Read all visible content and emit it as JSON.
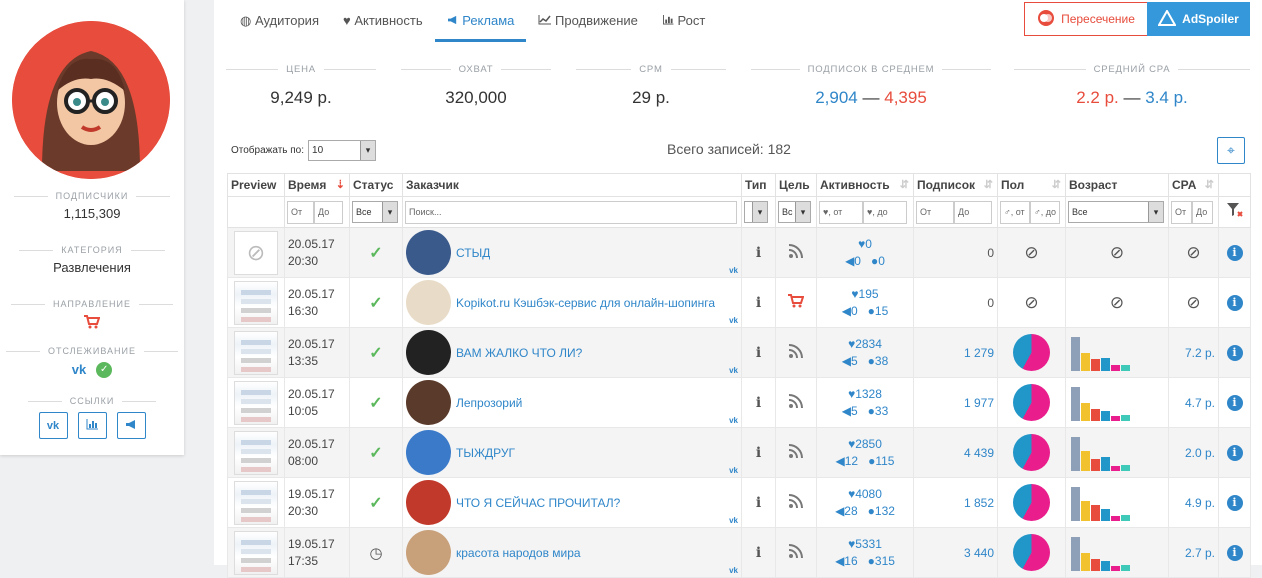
{
  "sidebar": {
    "subscribers_label": "ПОДПИСЧИКИ",
    "subscribers_value": "1,115,309",
    "category_label": "КАТЕГОРИЯ",
    "category_value": "Развлечения",
    "direction_label": "НАПРАВЛЕНИЕ",
    "tracking_label": "ОТСЛЕЖИВАНИЕ",
    "links_label": "ССЫЛКИ",
    "tracking_vk": "vk"
  },
  "tabs": [
    {
      "label": "Аудитория",
      "icon": "globe-icon"
    },
    {
      "label": "Активность",
      "icon": "heart-icon"
    },
    {
      "label": "Реклама",
      "icon": "megaphone-icon"
    },
    {
      "label": "Продвижение",
      "icon": "chart-line-icon"
    },
    {
      "label": "Рост",
      "icon": "bar-chart-icon"
    }
  ],
  "buttons": {
    "intersection": "Пересечение",
    "adspoiler": "AdSpoiler"
  },
  "stats": {
    "price_label": "ЦЕНА",
    "price_value": "9,249 р.",
    "reach_label": "ОХВАТ",
    "reach_value": "320,000",
    "cpm_label": "CPM",
    "cpm_value": "29 р.",
    "subs_label": "ПОДПИСОК В СРЕДНЕМ",
    "subs_min": "2,904",
    "subs_max": "4,395",
    "cpa_label": "СРЕДНИЙ CPA",
    "cpa_min": "2.2 р.",
    "cpa_max": "3.4 р.",
    "dash": "—"
  },
  "controls": {
    "show_label": "Отображать по:",
    "show_value": "10",
    "total": "Всего записей: 182"
  },
  "table": {
    "headers": {
      "preview": "Preview",
      "time": "Время",
      "status": "Статус",
      "customer": "Заказчик",
      "type": "Тип",
      "goal": "Цель",
      "activity": "Активность",
      "subs": "Подписок",
      "gender": "Пол",
      "age": "Возраст",
      "cpa": "CPA"
    },
    "filters": {
      "from": "От",
      "to": "До",
      "all": "Все",
      "search": "Поиск...",
      "vs": "Вс",
      "act_from": "♥, от",
      "act_to": "♥, до",
      "g_from": "♂, от",
      "g_to": "♂, до"
    },
    "rows": [
      {
        "date": "20.05.17",
        "time": "20:30",
        "name": "СТЫД",
        "likes": "0",
        "reposts": "0",
        "comments": "0",
        "subs": "0"
      },
      {
        "date": "20.05.17",
        "time": "16:30",
        "name": "Kopikot.ru Кэшбэк-сервис для онлайн-шопинга",
        "likes": "195",
        "reposts": "0",
        "comments": "15",
        "subs": "0"
      },
      {
        "date": "20.05.17",
        "time": "13:35",
        "name": "ВАМ ЖАЛКО ЧТО ЛИ?",
        "likes": "2834",
        "reposts": "5",
        "comments": "38",
        "subs": "1 279",
        "cpa": "7.2 р."
      },
      {
        "date": "20.05.17",
        "time": "10:05",
        "name": "Лепрозорий",
        "likes": "1328",
        "reposts": "5",
        "comments": "33",
        "subs": "1 977",
        "cpa": "4.7 р."
      },
      {
        "date": "20.05.17",
        "time": "08:00",
        "name": "ТЫЖДРУГ",
        "likes": "2850",
        "reposts": "12",
        "comments": "115",
        "subs": "4 439",
        "cpa": "2.0 р."
      },
      {
        "date": "19.05.17",
        "time": "20:30",
        "name": "ЧТО Я СЕЙЧАС ПРОЧИТАЛ?",
        "likes": "4080",
        "reposts": "28",
        "comments": "132",
        "subs": "1 852",
        "cpa": "4.9 р."
      },
      {
        "date": "19.05.17",
        "time": "17:35",
        "name": "красота народов мира",
        "likes": "5331",
        "reposts": "16",
        "comments": "315",
        "subs": "3 440",
        "cpa": "2.7 р."
      }
    ]
  },
  "colors": {
    "accent": "#2f86c9",
    "red": "#e74c3c",
    "green": "#5cb85c",
    "pie_female": "#e91e8c",
    "pie_male": "#2196c9"
  }
}
